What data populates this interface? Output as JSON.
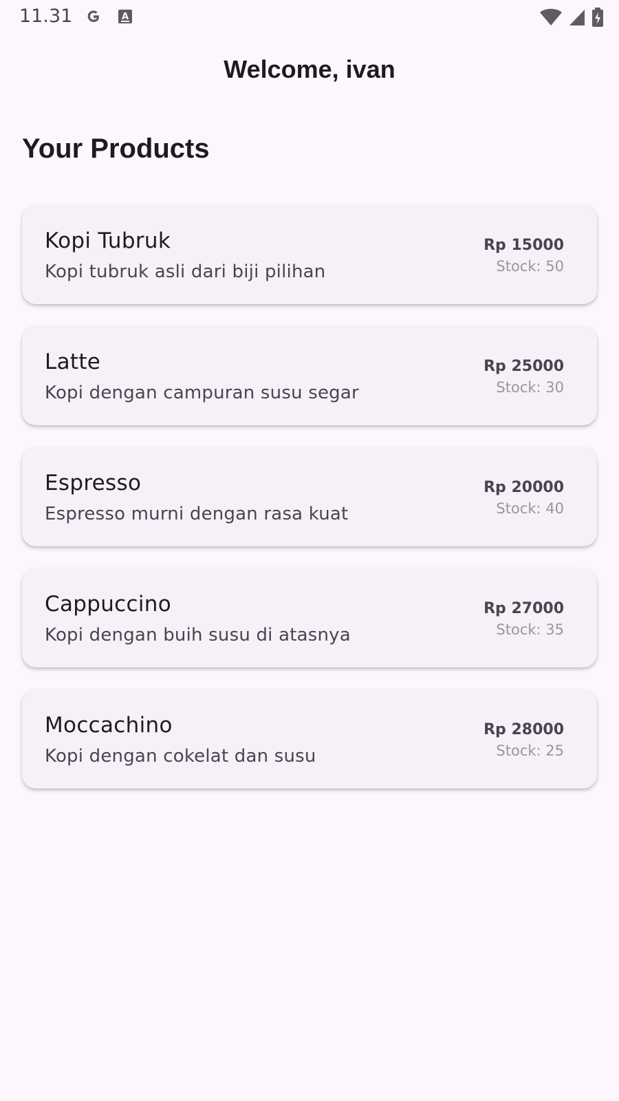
{
  "status_bar": {
    "time": "11.31",
    "left_icons": [
      "google-icon",
      "a-keyboard-icon"
    ],
    "right_icons": [
      "wifi-icon",
      "signal-icon",
      "battery-charging-icon"
    ]
  },
  "app_bar": {
    "title": "Welcome, ivan"
  },
  "section": {
    "title": "Your Products"
  },
  "products": [
    {
      "name": "Kopi Tubruk",
      "description": "Kopi tubruk asli dari biji pilihan",
      "price": "Rp 15000",
      "stock": "Stock: 50"
    },
    {
      "name": "Latte",
      "description": "Kopi dengan campuran susu segar",
      "price": "Rp 25000",
      "stock": "Stock: 30"
    },
    {
      "name": "Espresso",
      "description": "Espresso murni dengan rasa kuat",
      "price": "Rp 20000",
      "stock": "Stock: 40"
    },
    {
      "name": "Cappuccino",
      "description": "Kopi dengan buih susu di atasnya",
      "price": "Rp 27000",
      "stock": "Stock: 35"
    },
    {
      "name": "Moccachino",
      "description": "Kopi dengan cokelat dan susu",
      "price": "Rp 28000",
      "stock": "Stock: 25"
    }
  ],
  "colors": {
    "background": "#fdf7fd",
    "card": "#f6f1f8",
    "text_primary": "#1d1b20",
    "text_secondary": "#49454f",
    "text_muted": "#9a959e"
  }
}
